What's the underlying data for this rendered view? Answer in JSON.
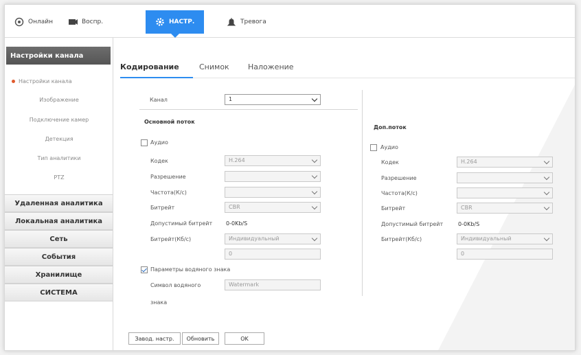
{
  "nav": {
    "items": [
      {
        "label": "Онлайн",
        "icon": "live-view-icon"
      },
      {
        "label": "Воспр.",
        "icon": "playback-icon"
      },
      {
        "label": "НАСТР.",
        "icon": "gear-icon"
      },
      {
        "label": "Тревога",
        "icon": "alarm-icon"
      }
    ],
    "active_color": "#2d8cf0"
  },
  "sidebar": {
    "header": "Настройки канала",
    "sub_items": [
      "Настройки канала",
      "Изображение",
      "Подключение камер",
      "Детекция",
      "Тип аналитики",
      "PTZ"
    ],
    "groups": [
      "Удаленная аналитика",
      "Локальная аналитика",
      "Сеть",
      "События",
      "Хранилище",
      "СИСТЕМА"
    ]
  },
  "tabs": [
    "Кодирование",
    "Снимок",
    "Наложение"
  ],
  "channel": {
    "label": "Канал",
    "value": "1"
  },
  "main_stream": {
    "title": "Основной поток",
    "audio_label": "Аудио",
    "audio_checked": false,
    "codec": {
      "label": "Кодек",
      "value": "H.264"
    },
    "resolution": {
      "label": "Разрешение",
      "value": ""
    },
    "framerate": {
      "label": "Частота(К/с)",
      "value": ""
    },
    "bitrate_type": {
      "label": "Битрейт",
      "value": "CBR"
    },
    "bitrate_range": {
      "label": "Допустимый битрейт",
      "value": "0-0Kb/S"
    },
    "bitrate": {
      "label": "Битрейт(Кб/с)",
      "value": "Индивидуальный"
    },
    "bitrate_custom": "0"
  },
  "watermark": {
    "label": "Параметры водяного знака",
    "checked": true,
    "char_label_1": "Символ водяного",
    "char_label_2": "знака",
    "placeholder": "Watermark"
  },
  "sub_stream": {
    "title": "Доп.поток",
    "audio_label": "Аудио",
    "audio_checked": false,
    "codec": {
      "label": "Кодек",
      "value": "H.264"
    },
    "resolution": {
      "label": "Разрешение",
      "value": ""
    },
    "framerate": {
      "label": "Частота(К/с)",
      "value": ""
    },
    "bitrate_type": {
      "label": "Битрейт",
      "value": "CBR"
    },
    "bitrate_range": {
      "label": "Допустимый битрейт",
      "value": "0-0Kb/S"
    },
    "bitrate": {
      "label": "Битрейт(Кб/с)",
      "value": "Индивидуальный"
    },
    "bitrate_custom": "0"
  },
  "buttons": {
    "default": "Завод. настр.",
    "refresh": "Обновить",
    "ok": "OK"
  }
}
